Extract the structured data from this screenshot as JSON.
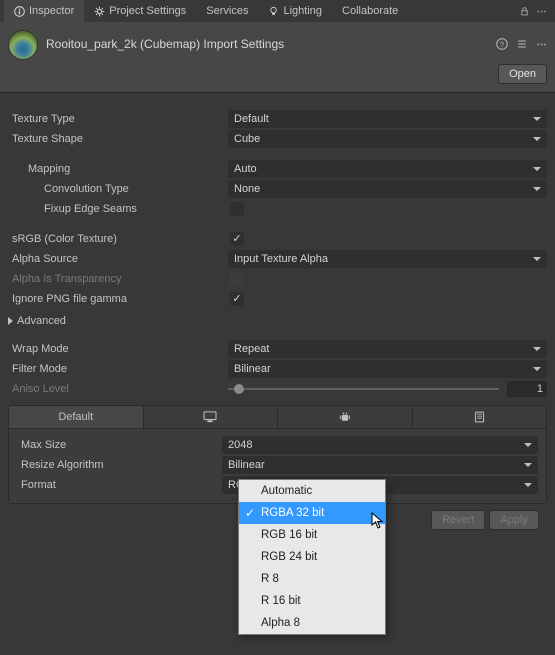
{
  "tabs": {
    "inspector": "Inspector",
    "project_settings": "Project Settings",
    "services": "Services",
    "lighting": "Lighting",
    "collaborate": "Collaborate"
  },
  "header": {
    "title": "Rooitou_park_2k (Cubemap) Import Settings",
    "open": "Open"
  },
  "fields": {
    "texture_type_label": "Texture Type",
    "texture_type_value": "Default",
    "texture_shape_label": "Texture Shape",
    "texture_shape_value": "Cube",
    "mapping_label": "Mapping",
    "mapping_value": "Auto",
    "convolution_label": "Convolution Type",
    "convolution_value": "None",
    "fixup_label": "Fixup Edge Seams",
    "srgb_label": "sRGB (Color Texture)",
    "alpha_source_label": "Alpha Source",
    "alpha_source_value": "Input Texture Alpha",
    "alpha_transparency_label": "Alpha Is Transparency",
    "ignore_png_label": "Ignore PNG file gamma",
    "advanced_label": "Advanced",
    "wrap_mode_label": "Wrap Mode",
    "wrap_mode_value": "Repeat",
    "filter_mode_label": "Filter Mode",
    "filter_mode_value": "Bilinear",
    "aniso_label": "Aniso Level",
    "aniso_value": "1"
  },
  "platform_tabs": {
    "default": "Default"
  },
  "platform": {
    "max_size_label": "Max Size",
    "max_size_value": "2048",
    "resize_label": "Resize Algorithm",
    "resize_value": "Bilinear",
    "format_label": "Format",
    "format_value": "RGBA 32 bit"
  },
  "format_menu": [
    "Automatic",
    "RGBA 32 bit",
    "RGB 16 bit",
    "RGB 24 bit",
    "R 8",
    "R 16 bit",
    "Alpha 8"
  ],
  "format_selected": "RGBA 32 bit",
  "buttons": {
    "revert": "Revert",
    "apply": "Apply"
  }
}
